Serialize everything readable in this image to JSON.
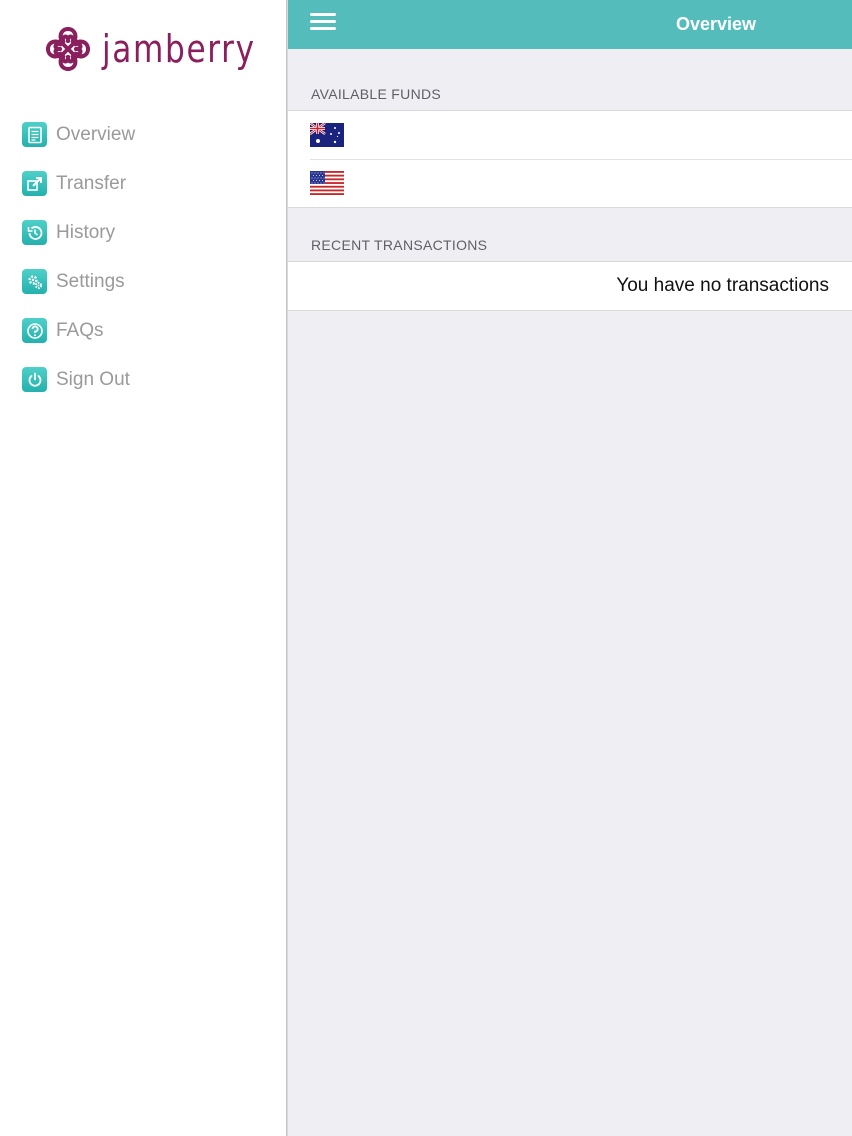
{
  "brand": {
    "name": "jamberry",
    "color": "#8a1f5e"
  },
  "colors": {
    "accent": "#54bcbb",
    "icon_gradient_top": "#4fd0c9",
    "icon_gradient_bottom": "#24b1ad",
    "background": "#efeef3"
  },
  "sidebar": {
    "items": [
      {
        "label": "Overview",
        "icon": "document-icon"
      },
      {
        "label": "Transfer",
        "icon": "transfer-icon"
      },
      {
        "label": "History",
        "icon": "history-icon"
      },
      {
        "label": "Settings",
        "icon": "gears-icon"
      },
      {
        "label": "FAQs",
        "icon": "question-icon"
      },
      {
        "label": "Sign Out",
        "icon": "power-icon"
      }
    ]
  },
  "header": {
    "title": "Overview",
    "menu_icon": "hamburger-menu-icon"
  },
  "funds": {
    "header": "AVAILABLE FUNDS",
    "rows": [
      {
        "flag": "australia-flag-icon"
      },
      {
        "flag": "usa-flag-icon"
      }
    ]
  },
  "transactions": {
    "header": "RECENT TRANSACTIONS",
    "empty_message": "You have no transactions"
  }
}
